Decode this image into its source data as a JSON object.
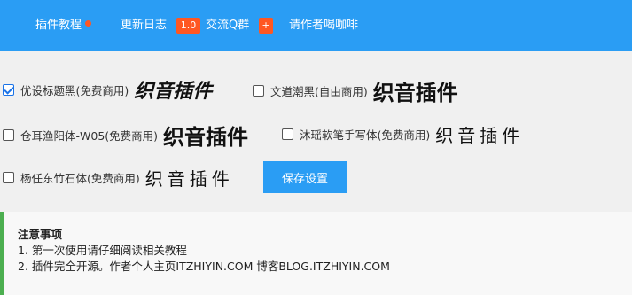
{
  "nav": {
    "tutorial": "插件教程",
    "changelog": "更新日志",
    "version_badge": "1.0",
    "qq_group": "交流Q群",
    "qq_badge": "+",
    "coffee": "请作者喝咖啡"
  },
  "fonts": [
    {
      "label": "优设标题黑(免费商用)",
      "sample": "织音插件",
      "checked": true
    },
    {
      "label": "文道潮黑(自由商用)",
      "sample": "织音插件",
      "checked": false
    },
    {
      "label": "仓耳渔阳体-W05(免费商用)",
      "sample": "织音插件",
      "checked": false
    },
    {
      "label": "沐瑶软笔手写体(免费商用)",
      "sample": "织音插件",
      "checked": false
    },
    {
      "label": "杨任东竹石体(免费商用)",
      "sample": "织音插件",
      "checked": false
    }
  ],
  "save_button": "保存设置",
  "notice": {
    "title": "注意事项",
    "lines": [
      "1. 第一次使用请仔细阅读相关教程",
      "2. 插件完全开源。作者个人主页ITZHIYIN.COM 博客BLOG.ITZHIYIN.COM"
    ]
  },
  "colors": {
    "topbar": "#2a9df4",
    "badge": "#ff5722",
    "notice_border": "#4caf50"
  }
}
